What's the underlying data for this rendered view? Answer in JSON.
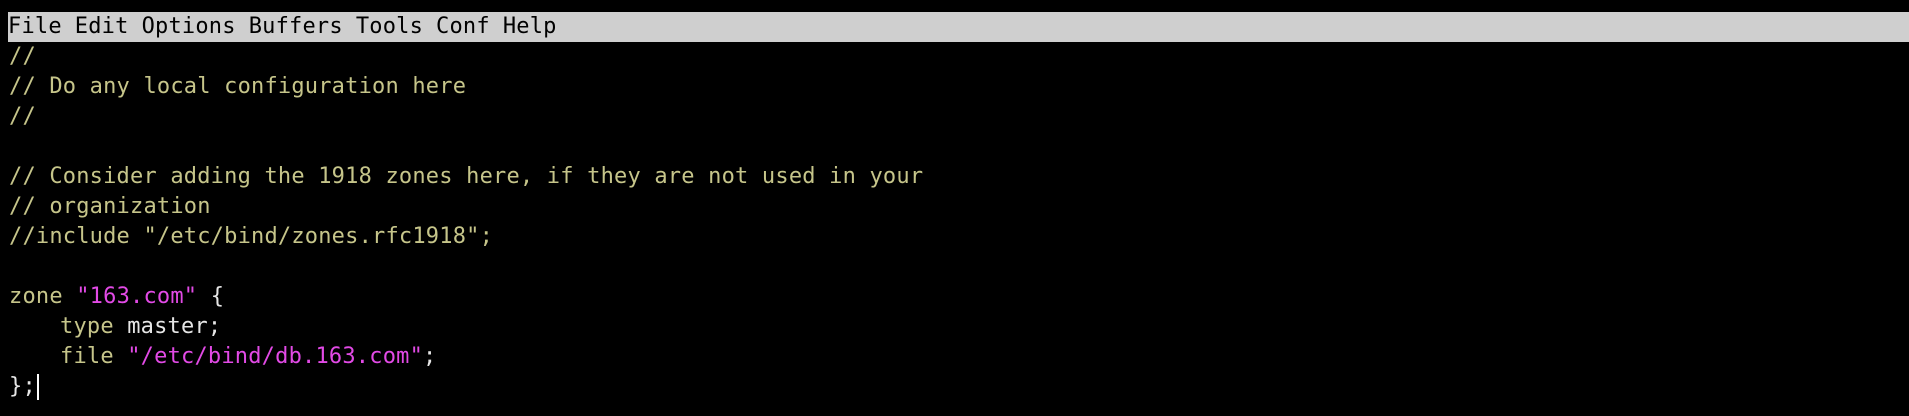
{
  "menu": {
    "items": [
      "File",
      "Edit",
      "Options",
      "Buffers",
      "Tools",
      "Conf",
      "Help"
    ]
  },
  "editor": {
    "lines": {
      "l1": "//",
      "l2": "// Do any local configuration here",
      "l3": "//",
      "l4": "",
      "l5": "// Consider adding the 1918 zones here, if they are not used in your",
      "l6": "// organization",
      "l7": "//include \"/etc/bind/zones.rfc1918\";",
      "l8": "",
      "l9": {
        "kw": "zone",
        "str": "\"163.com\"",
        "brace": " {"
      },
      "l10": {
        "kw": "type",
        "val": " master;"
      },
      "l11": {
        "kw": "file",
        "str": "\"/etc/bind/db.163.com\"",
        "end": ";"
      },
      "l12": "};"
    }
  },
  "colors": {
    "background": "#000000",
    "menubar": "#cfcfcf",
    "comment": "#c6c58a",
    "string": "#e24ae6",
    "plain": "#e6e6e6"
  }
}
